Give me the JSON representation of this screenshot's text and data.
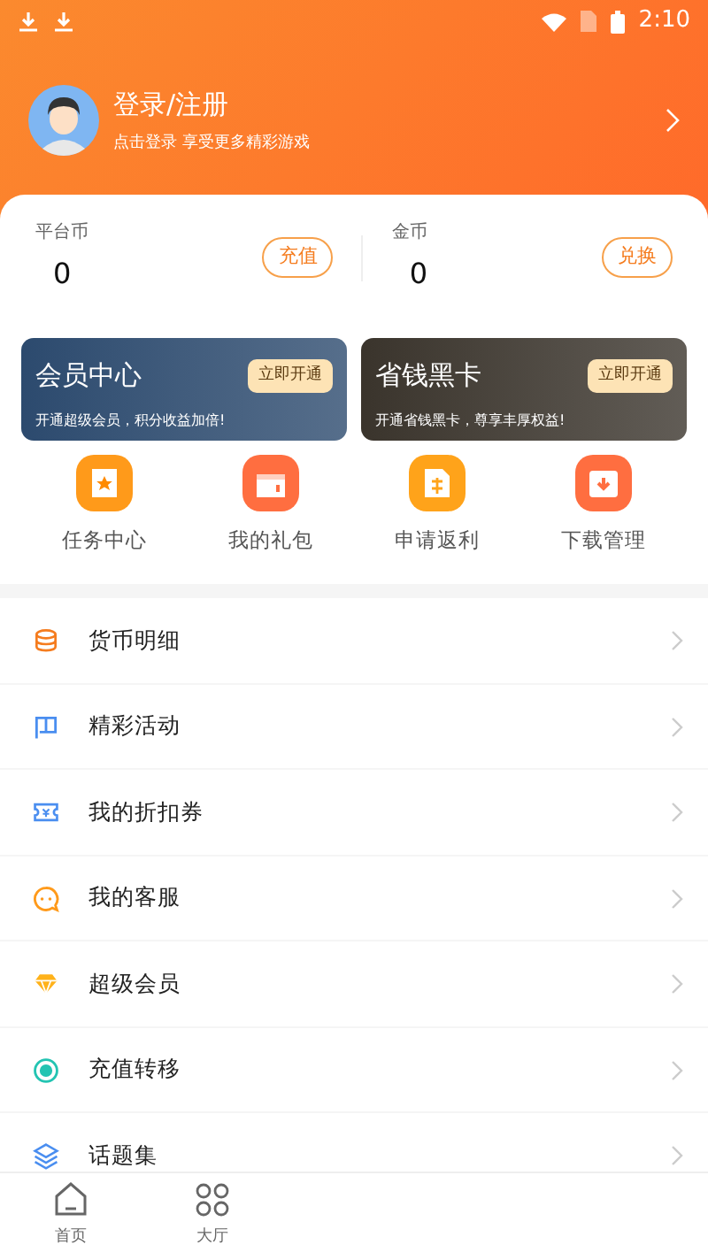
{
  "status_bar": {
    "time": "2:10"
  },
  "profile": {
    "title": "登录/注册",
    "subtitle": "点击登录  享受更多精彩游戏"
  },
  "wallets": [
    {
      "label": "平台币",
      "value": "0",
      "action": "充值"
    },
    {
      "label": "金币",
      "value": "0",
      "action": "兑换"
    }
  ],
  "promo_cards": [
    {
      "title": "会员中心",
      "button": "立即开通",
      "description": "开通超级会员，积分收益加倍!",
      "color": "#2c4a6e"
    },
    {
      "title": "省钱黑卡",
      "button": "立即开通",
      "description": "开通省钱黑卡，尊享丰厚权益!",
      "color": "#3a342c"
    }
  ],
  "shortcuts": [
    {
      "label": "任务中心"
    },
    {
      "label": "我的礼包"
    },
    {
      "label": "申请返利"
    },
    {
      "label": "下载管理"
    }
  ],
  "menu": [
    {
      "label": "货币明细"
    },
    {
      "label": "精彩活动"
    },
    {
      "label": "我的折扣券"
    },
    {
      "label": "我的客服"
    },
    {
      "label": "超级会员"
    },
    {
      "label": "充值转移"
    },
    {
      "label": "话题集"
    }
  ],
  "tabs": [
    {
      "label": "首页",
      "selected": false
    },
    {
      "label": "大厅",
      "selected": false
    }
  ]
}
